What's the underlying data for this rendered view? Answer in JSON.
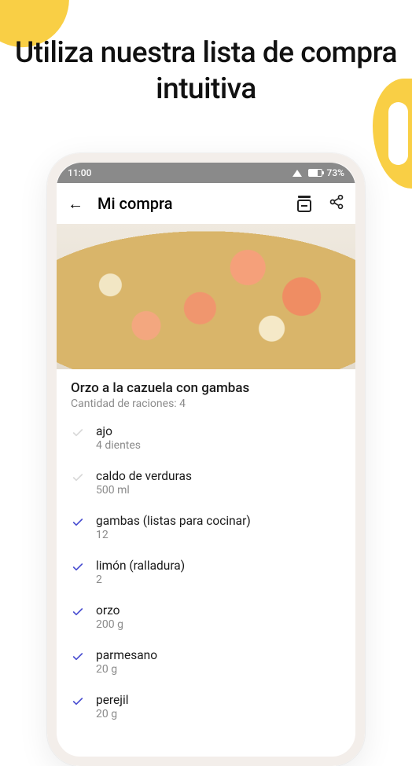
{
  "headline": "Utiliza nuestra lista de compra intuitiva",
  "status": {
    "time": "11:00",
    "battery_text": "73%"
  },
  "appbar": {
    "title": "Mi compra"
  },
  "recipe": {
    "title": "Orzo a la cazuela con gambas",
    "servings_label": "Cantidad de raciones: 4"
  },
  "ingredients": [
    {
      "name": "ajo",
      "qty": "4 dientes",
      "checked": false
    },
    {
      "name": "caldo de verduras",
      "qty": "500 ml",
      "checked": false
    },
    {
      "name": "gambas (listas para cocinar)",
      "qty": "12",
      "checked": true
    },
    {
      "name": "limón (ralladura)",
      "qty": "2",
      "checked": true
    },
    {
      "name": "orzo",
      "qty": "200 g",
      "checked": true
    },
    {
      "name": "parmesano",
      "qty": "20 g",
      "checked": true
    },
    {
      "name": "perejil",
      "qty": "20 g",
      "checked": true
    }
  ]
}
